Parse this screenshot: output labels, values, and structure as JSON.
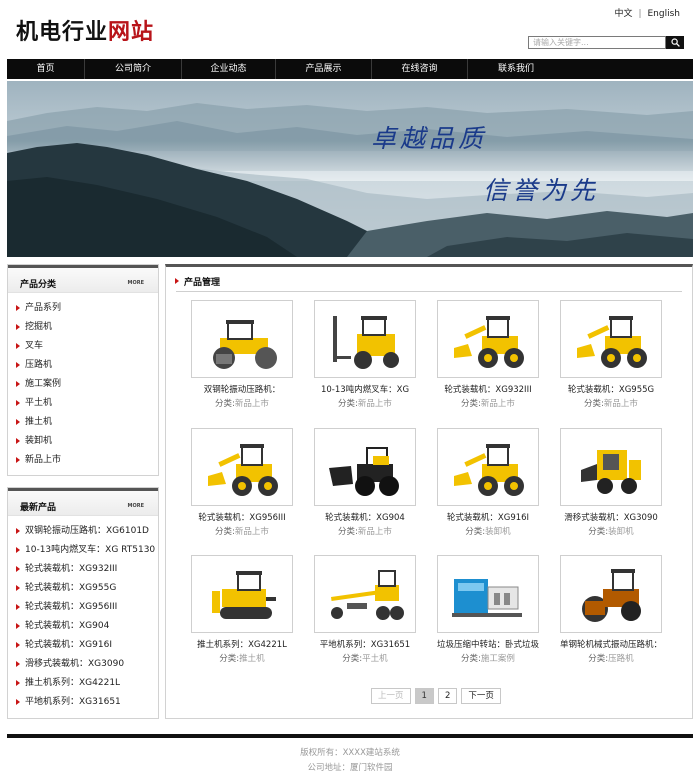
{
  "header": {
    "title_dark": "机电行业",
    "title_red": "网站",
    "lang_cn": "中文",
    "lang_sep": "|",
    "lang_en": "English",
    "search_placeholder": "请输入关键字..."
  },
  "nav": [
    "首页",
    "公司简介",
    "企业动态",
    "产品展示",
    "在线咨询",
    "联系我们"
  ],
  "banner": {
    "slogan_1": "卓越品质",
    "slogan_2": "信誉为先"
  },
  "sidebar": {
    "categories": {
      "title": "产品分类",
      "more": "MORE",
      "items": [
        "产品系列",
        "挖掘机",
        "叉车",
        "压路机",
        "施工案例",
        "平土机",
        "推土机",
        "装卸机",
        "新品上市"
      ]
    },
    "latest": {
      "title": "最新产品",
      "more": "MORE",
      "items": [
        "双钢轮振动压路机：XG6101D",
        "10-13吨内燃叉车：XG RT5130",
        "轮式装载机：XG932III",
        "轮式装载机：XG955G",
        "轮式装载机：XG956III",
        "轮式装载机：XG904",
        "轮式装载机：XG916I",
        "滑移式装载机：XG3090",
        "推土机系列：XG4221L",
        "平地机系列：XG31651"
      ]
    }
  },
  "main": {
    "title": "产品管理",
    "category_prefix": "分类:",
    "products": [
      {
        "name": "双钢轮振动压路机：",
        "category": "新品上市",
        "icon": "roller-icon"
      },
      {
        "name": "10-13吨内燃叉车：XG",
        "category": "新品上市",
        "icon": "forklift-icon"
      },
      {
        "name": "轮式装载机：XG932III",
        "category": "新品上市",
        "icon": "loader-icon"
      },
      {
        "name": "轮式装载机：XG955G",
        "category": "新品上市",
        "icon": "loader-icon"
      },
      {
        "name": "轮式装载机：XG956III",
        "category": "新品上市",
        "icon": "loader-icon"
      },
      {
        "name": "轮式装载机：XG904",
        "category": "新品上市",
        "icon": "black-loader-icon"
      },
      {
        "name": "轮式装载机：XG916I",
        "category": "装卸机",
        "icon": "loader-icon"
      },
      {
        "name": "滑移式装载机：XG3090",
        "category": "装卸机",
        "icon": "skid-steer-icon"
      },
      {
        "name": "推土机系列：XG4221L",
        "category": "推土机",
        "icon": "bulldozer-icon"
      },
      {
        "name": "平地机系列：XG31651",
        "category": "平土机",
        "icon": "grader-icon"
      },
      {
        "name": "垃圾压缩中转站：卧式垃圾",
        "category": "施工案例",
        "icon": "compactor-station-icon"
      },
      {
        "name": "单钢轮机械式振动压路机：",
        "category": "压路机",
        "icon": "single-drum-roller-icon"
      }
    ],
    "pager": {
      "prev": "上一页",
      "pages": [
        "1",
        "2"
      ],
      "next": "下一页"
    }
  },
  "footer": {
    "copyright": "版权所有：XXXX建站系统",
    "address": "公司地址：厦门软件园"
  },
  "colors": {
    "accent_red": "#b8141a",
    "machine_yellow": "#f2c200",
    "nav_bg": "#0b0b0b"
  }
}
